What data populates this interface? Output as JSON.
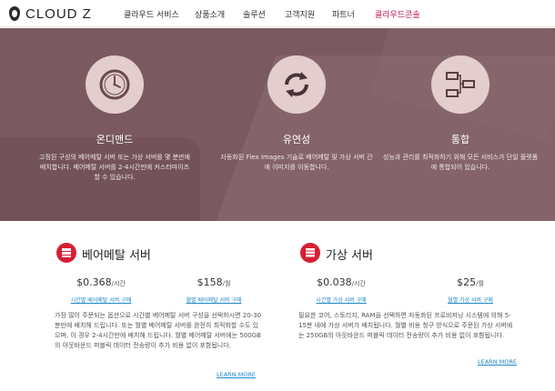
{
  "header": {
    "logo_text": "CLOUD Z",
    "nav": [
      {
        "label": "클라우드 서비스"
      },
      {
        "label": "상품소개"
      },
      {
        "label": "솔루션"
      },
      {
        "label": "고객지원"
      },
      {
        "label": "파트너"
      },
      {
        "label": "클라우드콘솔"
      }
    ],
    "accent_color": "#c2185b"
  },
  "hero": {
    "background_color": "#7a5a60",
    "features": [
      {
        "icon": "clock-icon",
        "title": "온디맨드",
        "description": "고정된 구성의 베어메탈 서버 또는 가상 서버를 몇 분만에 배치합니다. 베어메탈 서버를 2-4시간만에 커스터마이즈 할 수 있습니다."
      },
      {
        "icon": "refresh-arrows-icon",
        "title": "유연성",
        "description": "자동화된 Flex Images 기술로 베어메탈 및 가상 서버 간에 이미지를 이동합니다."
      },
      {
        "icon": "network-diagram-icon",
        "title": "통합",
        "description": "성능과 관리를 최적화하기 위해 모든 서비스가 단일 플랫폼에 통합되어 있습니다."
      }
    ]
  },
  "products": [
    {
      "icon": "server-icon",
      "title": "베어메탈 서버",
      "hourly_price": "$0.368",
      "hourly_unit": "/시간",
      "hourly_link": "시간별 베어메탈 서버 구매",
      "monthly_price": "$158",
      "monthly_unit": "/월",
      "monthly_link": "월별 베어메탈 서버 구매",
      "description": "가장 많이 주문되는 옵션으로 시간별 베어메탈 서버 구성을 선택하시면 20-30분만에 배치해 드립니다. 또는 월별 베어메탈 서버를 완전히 최적화할 수도 있으며, 이 경우 2-4시간만에 배치해 드립니다. 월별 베어메탈 서버에는 500GB의 아웃바운드 퍼블릭 데이터 전송량이 추가 비용 없이 포함됩니다.",
      "learn_more": "LEARN MORE"
    },
    {
      "icon": "server-stack-icon",
      "title": "가상 서버",
      "hourly_price": "$0.038",
      "hourly_unit": "/시간",
      "hourly_link": "시간별 가상 서버 구매",
      "monthly_price": "$25",
      "monthly_unit": "/월",
      "monthly_link": "월별 가상 서버 구매",
      "description": "필요한 코어, 스토리지, RAM을 선택하면 자동화된 프로비저닝 시스템에 의해 5-15분 내에 가상 서버가 배치됩니다. 월별 비용 청구 방식으로 주문된 가상 서버에는 250GB의 아웃바운드 퍼블릭 데이터 전송량이 추가 비용 없이 포함됩니다.",
      "learn_more": "LEARN MORE"
    }
  ],
  "colors": {
    "product_icon": "#d61f35",
    "link": "#1e88c8"
  }
}
